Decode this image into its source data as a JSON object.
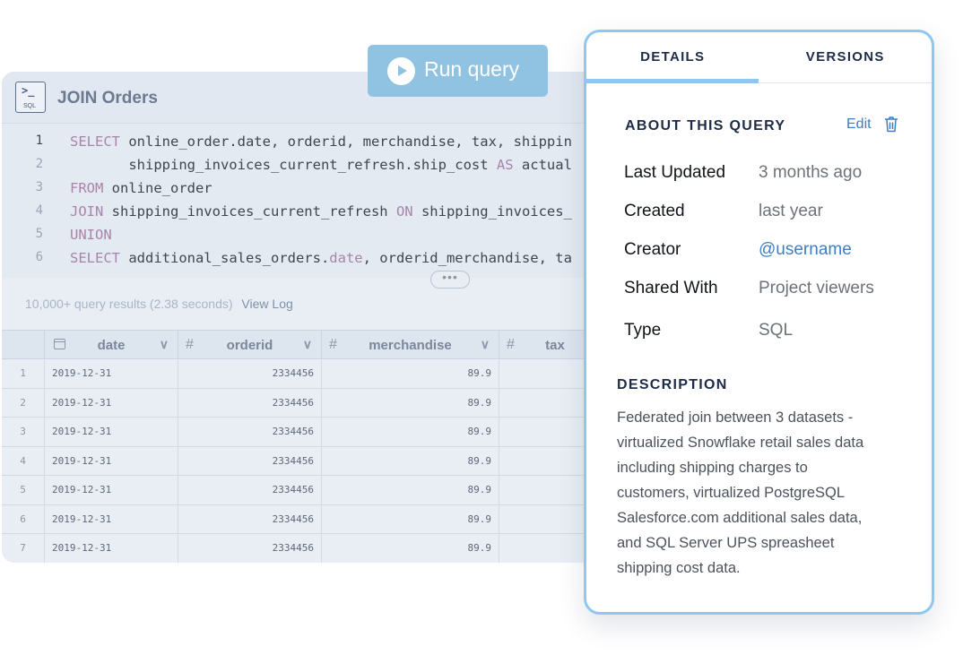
{
  "editor": {
    "title": "JOIN Orders",
    "icon_text": "SQL",
    "code_lines": [
      {
        "n": "1",
        "parts": [
          [
            "kw",
            "SELECT"
          ],
          [
            "t",
            " online_order.date, orderid, merchandise, tax, shippin"
          ]
        ]
      },
      {
        "n": "2",
        "parts": [
          [
            "t",
            "       shipping_invoices_current_refresh.ship_cost "
          ],
          [
            "kw",
            "AS"
          ],
          [
            "t",
            " actual"
          ]
        ]
      },
      {
        "n": "3",
        "parts": [
          [
            "kw",
            "FROM"
          ],
          [
            "t",
            " online_order"
          ]
        ]
      },
      {
        "n": "4",
        "parts": [
          [
            "kw",
            "JOIN"
          ],
          [
            "t",
            " shipping_invoices_current_refresh "
          ],
          [
            "kw",
            "ON"
          ],
          [
            "t",
            " shipping_invoices_"
          ]
        ]
      },
      {
        "n": "5",
        "parts": [
          [
            "kw",
            "UNION"
          ]
        ]
      },
      {
        "n": "6",
        "parts": [
          [
            "kw",
            "SELECT"
          ],
          [
            "t",
            " additional_sales_orders."
          ],
          [
            "fn",
            "date"
          ],
          [
            "t",
            ", orderid_merchandise, ta"
          ]
        ]
      }
    ],
    "results_summary": "10,000+ query results (2.38 seconds)",
    "view_log_label": "View Log",
    "columns": [
      {
        "type": "date",
        "name": "date"
      },
      {
        "type": "#",
        "name": "orderid"
      },
      {
        "type": "#",
        "name": "merchandise"
      },
      {
        "type": "#",
        "name": "tax"
      }
    ],
    "rows": [
      {
        "n": "1",
        "date": "2019-12-31",
        "orderid": "2334456",
        "merchandise": "89.9"
      },
      {
        "n": "2",
        "date": "2019-12-31",
        "orderid": "2334456",
        "merchandise": "89.9"
      },
      {
        "n": "3",
        "date": "2019-12-31",
        "orderid": "2334456",
        "merchandise": "89.9"
      },
      {
        "n": "4",
        "date": "2019-12-31",
        "orderid": "2334456",
        "merchandise": "89.9"
      },
      {
        "n": "5",
        "date": "2019-12-31",
        "orderid": "2334456",
        "merchandise": "89.9"
      },
      {
        "n": "6",
        "date": "2019-12-31",
        "orderid": "2334456",
        "merchandise": "89.9"
      },
      {
        "n": "7",
        "date": "2019-12-31",
        "orderid": "2334456",
        "merchandise": "89.9"
      }
    ]
  },
  "run_button": {
    "label": "Run query"
  },
  "panel": {
    "tabs": [
      {
        "label": "DETAILS",
        "active": true
      },
      {
        "label": "VERSIONS",
        "active": false
      }
    ],
    "about_heading": "ABOUT THIS QUERY",
    "edit_label": "Edit",
    "meta": [
      {
        "key": "Last Updated",
        "value": "3 months ago",
        "link": false
      },
      {
        "key": "Created",
        "value": "last year",
        "link": false
      },
      {
        "key": "Creator",
        "value": "@username",
        "link": true
      },
      {
        "key": "Shared With",
        "value": "Project viewers",
        "link": false
      },
      {
        "key": "Type",
        "value": "SQL",
        "link": false
      }
    ],
    "description_heading": "DESCRIPTION",
    "description_lines": [
      "Federated join between 3 datasets -",
      "virtualized Snowflake retail sales data",
      "including shipping charges to",
      "customers, virtualized PostgreSQL",
      "Salesforce.com additional sales data,",
      "and SQL Server UPS spreasheet",
      "shipping cost data."
    ]
  },
  "colors": {
    "accent": "#8ec8f0",
    "run_button": "#90c3e2",
    "link": "#3f7ec2",
    "keyword": "#a884aa"
  }
}
